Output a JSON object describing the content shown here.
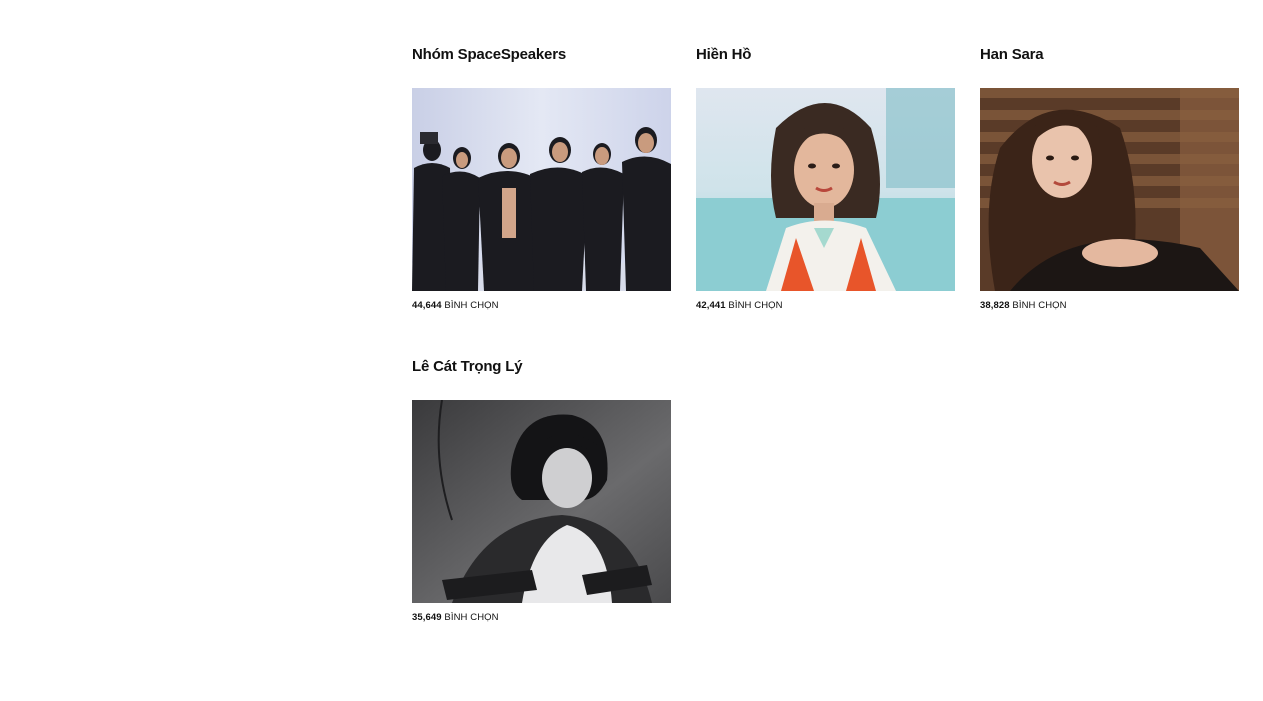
{
  "vote_suffix": "BÌNH CHỌN",
  "candidates": [
    {
      "name": "Nhóm SpaceSpeakers",
      "votes": "44,644",
      "image": "group-photo"
    },
    {
      "name": "Hiền Hồ",
      "votes": "42,441",
      "image": "portrait-photo"
    },
    {
      "name": "Han Sara",
      "votes": "38,828",
      "image": "portrait-photo"
    },
    {
      "name": "Lê Cát Trọng Lý",
      "votes": "35,649",
      "image": "portrait-photo"
    }
  ]
}
